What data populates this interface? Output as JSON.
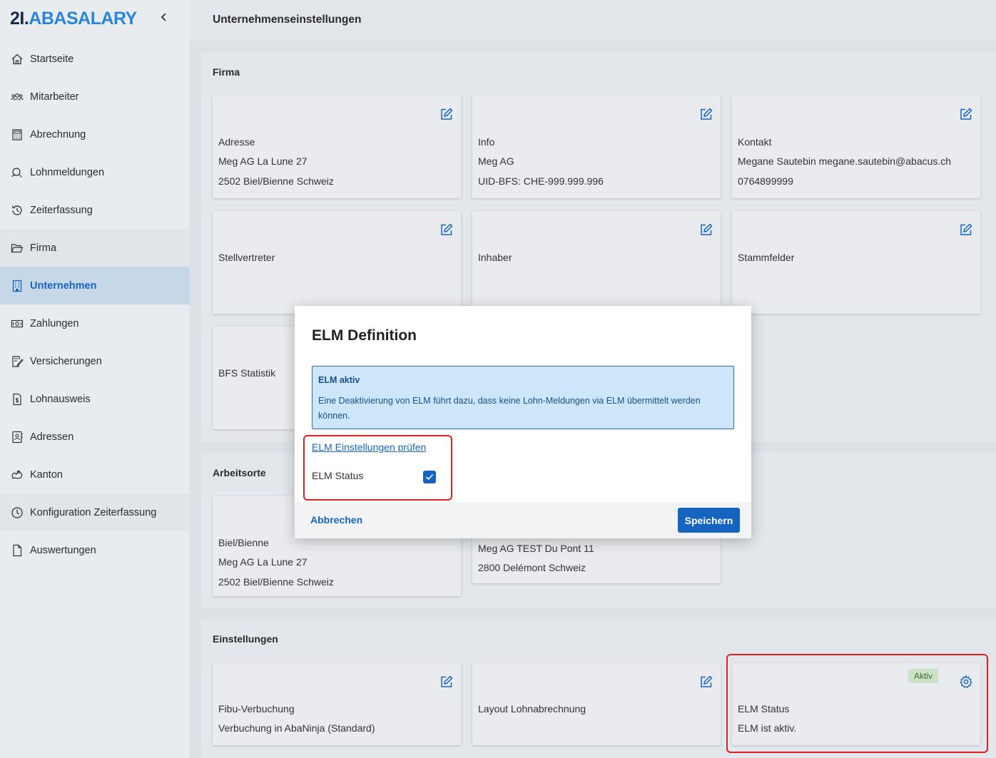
{
  "logo": {
    "part1": "2I.",
    "part2": "ABASALARY"
  },
  "sidebar": {
    "items": [
      {
        "label": "Startseite",
        "icon": "home-icon"
      },
      {
        "label": "Mitarbeiter",
        "icon": "users-icon"
      },
      {
        "label": "Abrechnung",
        "icon": "calculator-icon"
      },
      {
        "label": "Lohnmeldungen",
        "icon": "report-icon"
      },
      {
        "label": "Zeiterfassung",
        "icon": "history-icon"
      },
      {
        "label": "Firma",
        "icon": "folder-icon"
      },
      {
        "label": "Unternehmen",
        "icon": "building-icon"
      },
      {
        "label": "Zahlungen",
        "icon": "money-icon"
      },
      {
        "label": "Versicherungen",
        "icon": "contract-icon"
      },
      {
        "label": "Lohnausweis",
        "icon": "document-dollar-icon"
      },
      {
        "label": "Adressen",
        "icon": "contact-card-icon"
      },
      {
        "label": "Kanton",
        "icon": "map-icon"
      },
      {
        "label": "Konfiguration Zeiterfassung",
        "icon": "clock-icon"
      },
      {
        "label": "Auswertungen",
        "icon": "file-icon"
      }
    ]
  },
  "header": {
    "title": "Unternehmenseinstellungen"
  },
  "sections": {
    "firma": {
      "title": "Firma",
      "cards": [
        {
          "lines": [
            "Adresse",
            "Meg AG  La Lune 27",
            "2502 Biel/Bienne  Schweiz"
          ]
        },
        {
          "lines": [
            "Info",
            "Meg AG",
            "UID-BFS: CHE-999.999.996"
          ]
        },
        {
          "lines": [
            "Kontakt",
            "Megane Sautebin  megane.sautebin@abacus.ch",
            "0764899999"
          ]
        },
        {
          "lines": [
            "Stellvertreter"
          ]
        },
        {
          "lines": [
            "Inhaber"
          ]
        },
        {
          "lines": [
            "Stammfelder"
          ]
        },
        {
          "lines": [
            "BFS Statistik"
          ]
        }
      ]
    },
    "arbeitsorte": {
      "title": "Arbeitsorte",
      "cards": [
        {
          "lines": [
            "Biel/Bienne",
            "Meg AG  La Lune 27",
            "2502 Biel/Bienne  Schweiz"
          ]
        },
        {
          "lines": [
            "Meg AG TEST  Du Pont 11",
            "2800 Delémont  Schweiz"
          ]
        }
      ]
    },
    "einstellungen": {
      "title": "Einstellungen",
      "cards": [
        {
          "lines": [
            "Fibu-Verbuchung",
            "Verbuchung in AbaNinja (Standard)"
          ]
        },
        {
          "lines": [
            "Layout Lohnabrechnung"
          ]
        },
        {
          "lines": [
            "ELM Status",
            "ELM ist aktiv."
          ],
          "badge": "Aktiv"
        }
      ]
    }
  },
  "dialog": {
    "title": "ELM Definition",
    "info_title": "ELM aktiv",
    "info_text": "Eine Deaktivierung von ELM führt dazu, dass keine Lohn-Meldungen via ELM übermittelt werden können.",
    "link": "ELM Einstellungen prüfen",
    "status_label": "ELM Status",
    "status_checked": true,
    "cancel": "Abbrechen",
    "save": "Speichern"
  },
  "colors": {
    "accent": "#1565c0",
    "logo_blue": "#2a85d8",
    "highlight": "#e02020"
  }
}
